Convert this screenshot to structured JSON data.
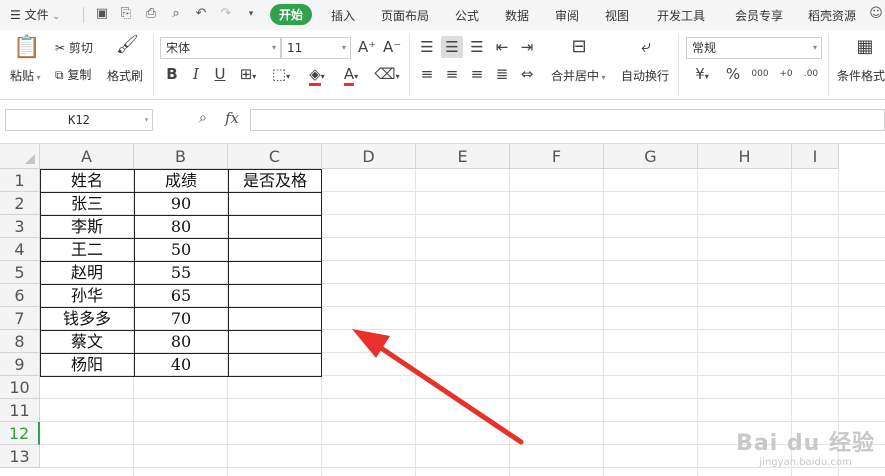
{
  "menubar": {
    "file_label": "文件",
    "tabs": [
      "开始",
      "插入",
      "页面布局",
      "公式",
      "数据",
      "审阅",
      "视图",
      "开发工具",
      "会员专享",
      "稻壳资源"
    ]
  },
  "ribbon": {
    "paste": "粘贴",
    "cut": "剪切",
    "copy": "复制",
    "format_painter": "格式刷",
    "font_name": "宋体",
    "font_size": "11",
    "bold": "B",
    "italic": "I",
    "underline": "U",
    "merge_center": "合并居中",
    "wrap_text": "自动换行",
    "number_format": "常规",
    "currency": "¥",
    "percent": "%",
    "thousands": "000",
    "inc_decimal": "+0",
    "dec_decimal": ".00",
    "conditional_format": "条件格式"
  },
  "formula_bar": {
    "name_box": "K12",
    "fx": "fx",
    "value": ""
  },
  "sheet": {
    "columns": [
      "A",
      "B",
      "C",
      "D",
      "E",
      "F",
      "G",
      "H",
      "I"
    ],
    "rows": [
      "1",
      "2",
      "3",
      "4",
      "5",
      "6",
      "7",
      "8",
      "9",
      "10",
      "11",
      "12",
      "13"
    ],
    "selected_row": "12",
    "headers": [
      "姓名",
      "成绩",
      "是否及格"
    ],
    "data": [
      [
        "张三",
        "90",
        ""
      ],
      [
        "李斯",
        "80",
        ""
      ],
      [
        "王二",
        "50",
        ""
      ],
      [
        "赵明",
        "55",
        ""
      ],
      [
        "孙华",
        "65",
        ""
      ],
      [
        "钱多多",
        "70",
        ""
      ],
      [
        "蔡文",
        "80",
        ""
      ],
      [
        "杨阳",
        "40",
        ""
      ]
    ]
  },
  "watermark": {
    "brand": "Bai du 经验",
    "url": "jingyan.baidu.com"
  },
  "colors": {
    "accent_green": "#31a14c",
    "arrow_red": "#e8312a"
  }
}
